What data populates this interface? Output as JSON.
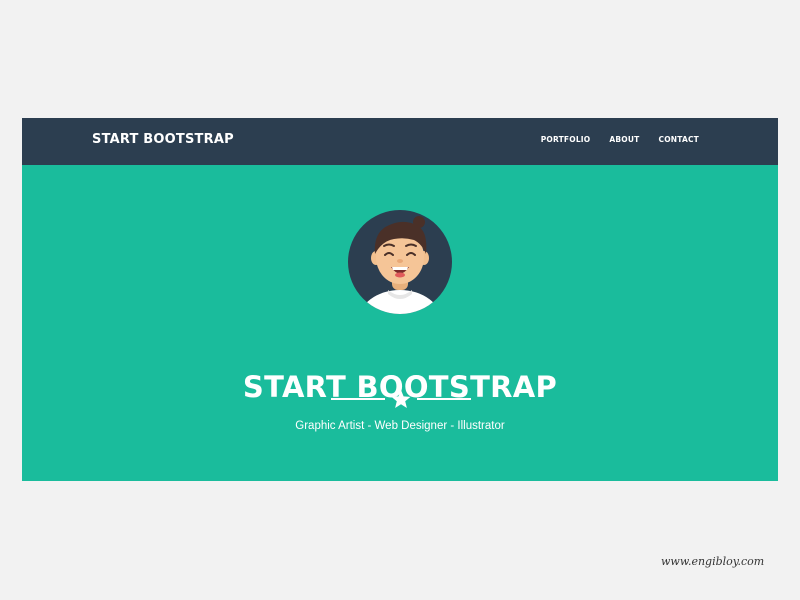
{
  "navbar": {
    "brand": "START BOOTSTRAP",
    "links": [
      "PORTFOLIO",
      "ABOUT",
      "CONTACT"
    ]
  },
  "masthead": {
    "avatar_icon": "avatar-illustration",
    "title": "START BOOTSTRAP",
    "divider_icon": "star-icon",
    "subtitle": "Graphic Artist - Web Designer - Illustrator"
  },
  "watermark": "www.engibloy.com",
  "colors": {
    "navbar": "#2c3e50",
    "masthead": "#1abc9c",
    "text": "#ffffff",
    "page_background": "#f2f2f2"
  }
}
